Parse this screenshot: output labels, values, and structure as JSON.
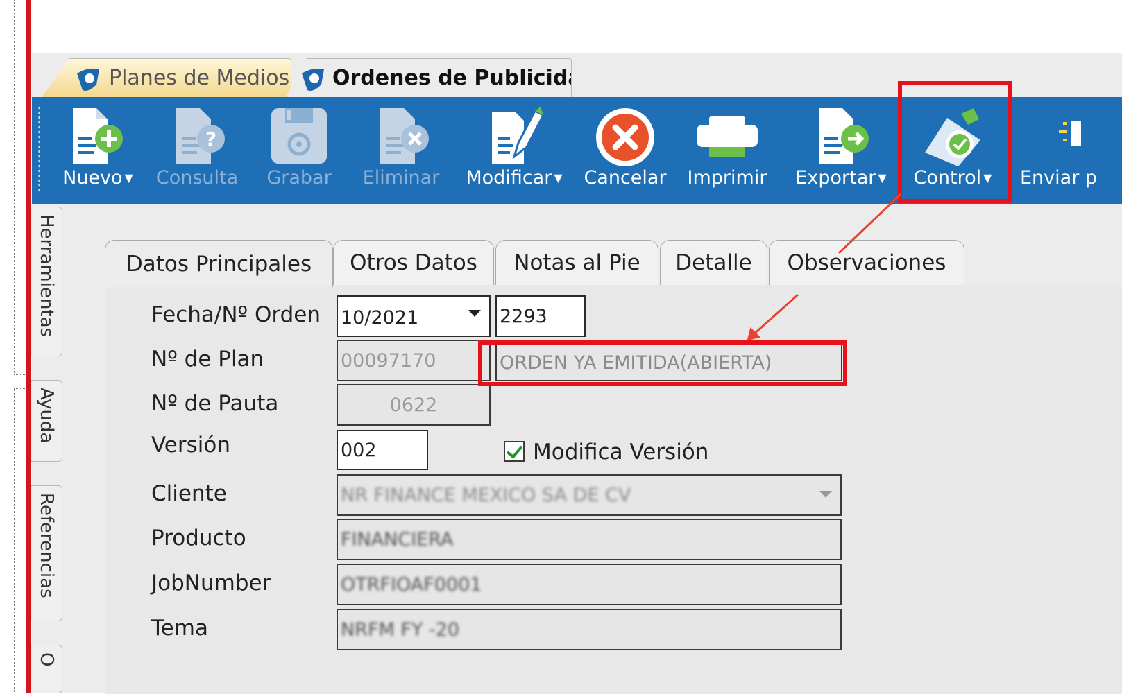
{
  "doc_tabs": {
    "inactive": "Planes de Medios",
    "active": "Ordenes de Publicidad"
  },
  "toolbar": {
    "buttons": [
      {
        "label": "Nuevo",
        "icon": "new-document-icon",
        "dropdown": true,
        "enabled": true
      },
      {
        "label": "Consulta",
        "icon": "query-document-icon",
        "dropdown": false,
        "enabled": false
      },
      {
        "label": "Grabar",
        "icon": "save-disk-icon",
        "dropdown": false,
        "enabled": false
      },
      {
        "label": "Eliminar",
        "icon": "delete-document-icon",
        "dropdown": false,
        "enabled": false
      },
      {
        "label": "Modificar",
        "icon": "edit-pencil-icon",
        "dropdown": true,
        "enabled": true
      },
      {
        "label": "Cancelar",
        "icon": "cancel-x-icon",
        "dropdown": false,
        "enabled": true
      },
      {
        "label": "Imprimir",
        "icon": "printer-icon",
        "dropdown": false,
        "enabled": true
      },
      {
        "label": "Exportar",
        "icon": "export-document-icon",
        "dropdown": true,
        "enabled": true
      },
      {
        "label": "Control",
        "icon": "control-check-icon",
        "dropdown": true,
        "enabled": true
      },
      {
        "label": "Enviar p",
        "icon": "send-icon",
        "dropdown": false,
        "enabled": true
      }
    ]
  },
  "side_tabs": [
    "Herramientas",
    "Ayuda",
    "Referencias",
    "O"
  ],
  "content_tabs": [
    "Datos Principales",
    "Otros Datos",
    "Notas al Pie",
    "Detalle",
    "Observaciones"
  ],
  "form": {
    "fecha_label": "Fecha/Nº Orden",
    "fecha_value": "10/2021",
    "orden_value": "2293",
    "plan_label": "Nº de Plan",
    "plan_value": "00097170",
    "plan_status": "ORDEN YA EMITIDA(ABIERTA)",
    "pauta_label": "Nº de Pauta",
    "pauta_value": "0622",
    "version_label": "Versión",
    "version_value": "002",
    "modifica_label": "Modifica Versión",
    "modifica_checked": true,
    "cliente_label": "Cliente",
    "cliente_value": "NR FINANCE MEXICO SA DE CV",
    "producto_label": "Producto",
    "producto_value": "FINANCIERA",
    "job_label": "JobNumber",
    "job_value": "OTRFIOAF0001",
    "tema_label": "Tema",
    "tema_value": "NRFM FY -20"
  },
  "colors": {
    "toolbar_bg": "#1e6fb5",
    "highlight": "#e8101a",
    "panel_bg": "#e8e8e8"
  }
}
